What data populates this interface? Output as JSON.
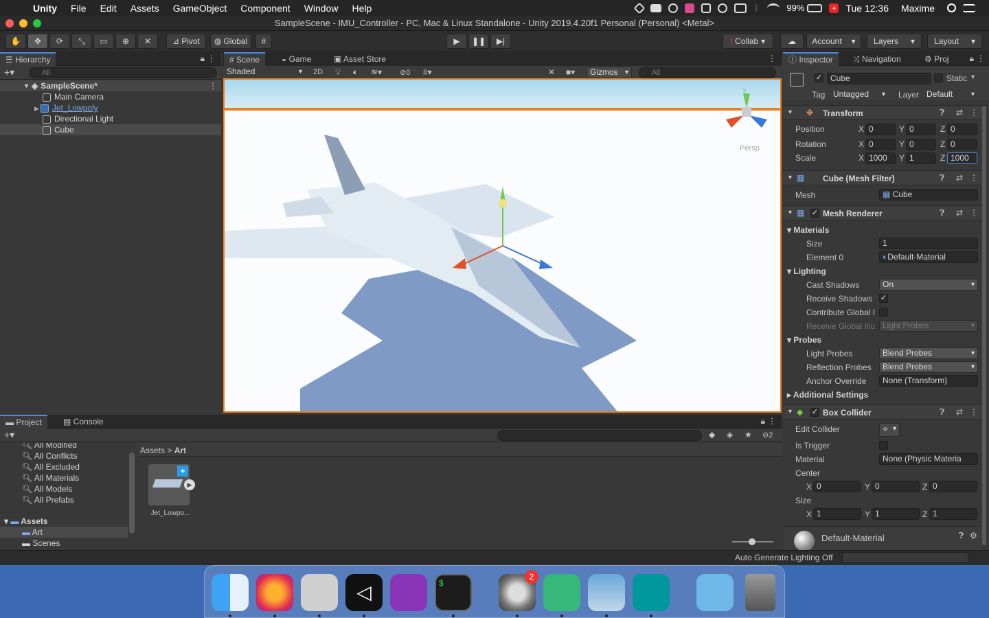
{
  "menubar": {
    "app": "Unity",
    "items": [
      "File",
      "Edit",
      "Assets",
      "GameObject",
      "Component",
      "Window",
      "Help"
    ],
    "battery": "99%",
    "clock": "Tue 12:36",
    "user": "Maxime"
  },
  "title": "SampleScene - IMU_Controller - PC, Mac & Linux Standalone - Unity 2019.4.20f1 Personal (Personal) <Metal>",
  "toolbar": {
    "pivot": "Pivot",
    "global": "Global",
    "collab": "Collab",
    "account": "Account",
    "layers": "Layers",
    "layout": "Layout"
  },
  "hierarchy": {
    "tab": "Hierarchy",
    "search": "All",
    "scene": "SampleScene*",
    "items": [
      "Main Camera",
      "Jet_Lowpoly",
      "Directional Light",
      "Cube"
    ]
  },
  "scene_panel": {
    "tabs": [
      "Scene",
      "Game",
      "Asset Store"
    ],
    "shading": "Shaded",
    "mode2d": "2D",
    "hidden_count": "0",
    "gizmos": "Gizmos",
    "search": "All",
    "persp": "Persp"
  },
  "inspector": {
    "tabs": [
      "Inspector",
      "Navigation",
      "Proj"
    ],
    "object_name": "Cube",
    "static": "Static",
    "tag_label": "Tag",
    "tag": "Untagged",
    "layer_label": "Layer",
    "layer": "Default",
    "transform": {
      "title": "Transform",
      "position_label": "Position",
      "rotation_label": "Rotation",
      "scale_label": "Scale",
      "position": [
        "0",
        "0",
        "0"
      ],
      "rotation": [
        "0",
        "0",
        "0"
      ],
      "scale": [
        "1000",
        "1",
        "1000"
      ]
    },
    "mesh_filter": {
      "title": "Cube (Mesh Filter)",
      "mesh_label": "Mesh",
      "mesh": "Cube"
    },
    "mesh_renderer": {
      "title": "Mesh Renderer",
      "materials": "Materials",
      "size_label": "Size",
      "size": "1",
      "element0_label": "Element 0",
      "element0": "Default-Material",
      "lighting": "Lighting",
      "cast_label": "Cast Shadows",
      "cast": "On",
      "receive_label": "Receive Shadows",
      "contribute_label": "Contribute Global I",
      "receive_gi_label": "Receive Global Illu",
      "receive_gi": "Light Probes",
      "probes": "Probes",
      "light_probes_label": "Light Probes",
      "light_probes": "Blend Probes",
      "reflection_label": "Reflection Probes",
      "reflection": "Blend Probes",
      "anchor_label": "Anchor Override",
      "anchor": "None (Transform)",
      "additional": "Additional Settings"
    },
    "box_collider": {
      "title": "Box Collider",
      "edit_label": "Edit Collider",
      "trigger_label": "Is Trigger",
      "material_label": "Material",
      "material": "None (Physic Materia",
      "center_label": "Center",
      "center": [
        "0",
        "0",
        "0"
      ],
      "size_label": "Size",
      "size": [
        "1",
        "1",
        "1"
      ]
    },
    "material_footer": "Default-Material"
  },
  "project": {
    "tabs": [
      "Project",
      "Console"
    ],
    "hidden_count": "2",
    "favorites": [
      "All Modified",
      "All Conflicts",
      "All Excluded",
      "All Materials",
      "All Models",
      "All Prefabs"
    ],
    "assets_root": "Assets",
    "folders": [
      "Art",
      "Scenes"
    ],
    "breadcrumb": [
      "Assets",
      "Art"
    ],
    "asset": "Jet_Lowpo..."
  },
  "status": "Auto Generate Lighting Off",
  "dock": {
    "badge": "2"
  }
}
